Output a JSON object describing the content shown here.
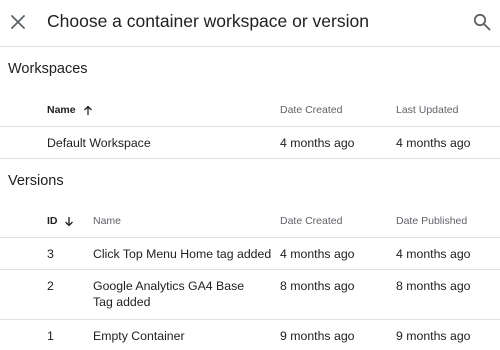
{
  "dialog": {
    "title": "Choose a container workspace or version"
  },
  "workspaces": {
    "heading": "Workspaces",
    "columns": {
      "name": "Name",
      "date_created": "Date Created",
      "last_updated": "Last Updated"
    },
    "rows": [
      {
        "name": "Default Workspace",
        "date_created": "4 months ago",
        "last_updated": "4 months ago"
      }
    ]
  },
  "versions": {
    "heading": "Versions",
    "columns": {
      "id": "ID",
      "name": "Name",
      "date_created": "Date Created",
      "date_published": "Date Published"
    },
    "rows": [
      {
        "id": "3",
        "name": "Click Top Menu Home tag added",
        "date_created": "4 months ago",
        "date_published": "4 months ago"
      },
      {
        "id": "2",
        "name": "Google Analytics GA4 Base Tag added",
        "date_created": "8 months ago",
        "date_published": "8 months ago"
      },
      {
        "id": "1",
        "name": "Empty Container",
        "date_created": "9 months ago",
        "date_published": "9 months ago"
      }
    ]
  }
}
